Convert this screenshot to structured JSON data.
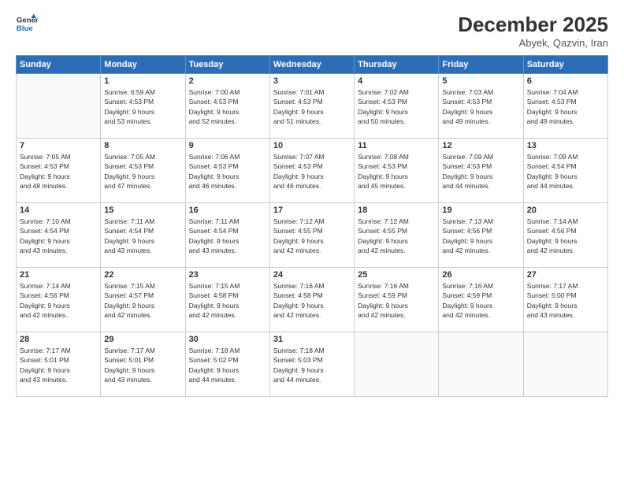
{
  "header": {
    "logo_line1": "General",
    "logo_line2": "Blue",
    "month_year": "December 2025",
    "location": "Abyek, Qazvin, Iran"
  },
  "days_of_week": [
    "Sunday",
    "Monday",
    "Tuesday",
    "Wednesday",
    "Thursday",
    "Friday",
    "Saturday"
  ],
  "weeks": [
    [
      {
        "day": "",
        "sunrise": "",
        "sunset": "",
        "daylight": "",
        "empty": true
      },
      {
        "day": "1",
        "sunrise": "6:59 AM",
        "sunset": "4:53 PM",
        "daylight": "9 hours and 53 minutes."
      },
      {
        "day": "2",
        "sunrise": "7:00 AM",
        "sunset": "4:53 PM",
        "daylight": "9 hours and 52 minutes."
      },
      {
        "day": "3",
        "sunrise": "7:01 AM",
        "sunset": "4:53 PM",
        "daylight": "9 hours and 51 minutes."
      },
      {
        "day": "4",
        "sunrise": "7:02 AM",
        "sunset": "4:53 PM",
        "daylight": "9 hours and 50 minutes."
      },
      {
        "day": "5",
        "sunrise": "7:03 AM",
        "sunset": "4:53 PM",
        "daylight": "9 hours and 49 minutes."
      },
      {
        "day": "6",
        "sunrise": "7:04 AM",
        "sunset": "4:53 PM",
        "daylight": "9 hours and 49 minutes."
      }
    ],
    [
      {
        "day": "7",
        "sunrise": "7:05 AM",
        "sunset": "4:53 PM",
        "daylight": "9 hours and 48 minutes."
      },
      {
        "day": "8",
        "sunrise": "7:05 AM",
        "sunset": "4:53 PM",
        "daylight": "9 hours and 47 minutes."
      },
      {
        "day": "9",
        "sunrise": "7:06 AM",
        "sunset": "4:53 PM",
        "daylight": "9 hours and 46 minutes."
      },
      {
        "day": "10",
        "sunrise": "7:07 AM",
        "sunset": "4:53 PM",
        "daylight": "9 hours and 46 minutes."
      },
      {
        "day": "11",
        "sunrise": "7:08 AM",
        "sunset": "4:53 PM",
        "daylight": "9 hours and 45 minutes."
      },
      {
        "day": "12",
        "sunrise": "7:09 AM",
        "sunset": "4:53 PM",
        "daylight": "9 hours and 44 minutes."
      },
      {
        "day": "13",
        "sunrise": "7:09 AM",
        "sunset": "4:54 PM",
        "daylight": "9 hours and 44 minutes."
      }
    ],
    [
      {
        "day": "14",
        "sunrise": "7:10 AM",
        "sunset": "4:54 PM",
        "daylight": "9 hours and 43 minutes."
      },
      {
        "day": "15",
        "sunrise": "7:11 AM",
        "sunset": "4:54 PM",
        "daylight": "9 hours and 43 minutes."
      },
      {
        "day": "16",
        "sunrise": "7:11 AM",
        "sunset": "4:54 PM",
        "daylight": "9 hours and 43 minutes."
      },
      {
        "day": "17",
        "sunrise": "7:12 AM",
        "sunset": "4:55 PM",
        "daylight": "9 hours and 42 minutes."
      },
      {
        "day": "18",
        "sunrise": "7:12 AM",
        "sunset": "4:55 PM",
        "daylight": "9 hours and 42 minutes."
      },
      {
        "day": "19",
        "sunrise": "7:13 AM",
        "sunset": "4:56 PM",
        "daylight": "9 hours and 42 minutes."
      },
      {
        "day": "20",
        "sunrise": "7:14 AM",
        "sunset": "4:56 PM",
        "daylight": "9 hours and 42 minutes."
      }
    ],
    [
      {
        "day": "21",
        "sunrise": "7:14 AM",
        "sunset": "4:56 PM",
        "daylight": "9 hours and 42 minutes."
      },
      {
        "day": "22",
        "sunrise": "7:15 AM",
        "sunset": "4:57 PM",
        "daylight": "9 hours and 42 minutes."
      },
      {
        "day": "23",
        "sunrise": "7:15 AM",
        "sunset": "4:58 PM",
        "daylight": "9 hours and 42 minutes."
      },
      {
        "day": "24",
        "sunrise": "7:16 AM",
        "sunset": "4:58 PM",
        "daylight": "9 hours and 42 minutes."
      },
      {
        "day": "25",
        "sunrise": "7:16 AM",
        "sunset": "4:59 PM",
        "daylight": "9 hours and 42 minutes."
      },
      {
        "day": "26",
        "sunrise": "7:16 AM",
        "sunset": "4:59 PM",
        "daylight": "9 hours and 42 minutes."
      },
      {
        "day": "27",
        "sunrise": "7:17 AM",
        "sunset": "5:00 PM",
        "daylight": "9 hours and 43 minutes."
      }
    ],
    [
      {
        "day": "28",
        "sunrise": "7:17 AM",
        "sunset": "5:01 PM",
        "daylight": "9 hours and 43 minutes."
      },
      {
        "day": "29",
        "sunrise": "7:17 AM",
        "sunset": "5:01 PM",
        "daylight": "9 hours and 43 minutes."
      },
      {
        "day": "30",
        "sunrise": "7:18 AM",
        "sunset": "5:02 PM",
        "daylight": "9 hours and 44 minutes."
      },
      {
        "day": "31",
        "sunrise": "7:18 AM",
        "sunset": "5:03 PM",
        "daylight": "9 hours and 44 minutes."
      },
      {
        "day": "",
        "sunrise": "",
        "sunset": "",
        "daylight": "",
        "empty": true
      },
      {
        "day": "",
        "sunrise": "",
        "sunset": "",
        "daylight": "",
        "empty": true
      },
      {
        "day": "",
        "sunrise": "",
        "sunset": "",
        "daylight": "",
        "empty": true
      }
    ]
  ]
}
